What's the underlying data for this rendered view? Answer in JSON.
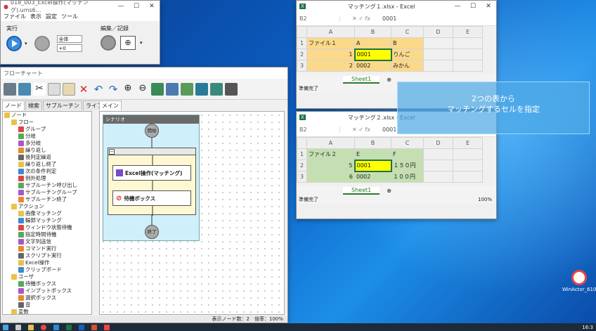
{
  "winactor_main": {
    "title": "018_003_Excel操作(マッチング).ums6...",
    "menu": [
      "ファイル",
      "表示",
      "設定",
      "ツール"
    ],
    "run_label": "実行",
    "edit_label": "編集／記録",
    "scope_value": "全体",
    "speed_value": "+0"
  },
  "flowchart": {
    "title": "フローチャート",
    "tabs": [
      "ノード",
      "検索",
      "サブルーチン",
      "ライブラリ"
    ],
    "main_tab": "メイン",
    "tree": [
      {
        "label": "ノード",
        "level": 0
      },
      {
        "label": "フロー",
        "level": 1
      },
      {
        "label": "グループ",
        "level": 2
      },
      {
        "label": "分岐",
        "level": 2
      },
      {
        "label": "多分岐",
        "level": 2
      },
      {
        "label": "繰り返し",
        "level": 2
      },
      {
        "label": "後判定繰返",
        "level": 2
      },
      {
        "label": "繰り返し終了",
        "level": 2
      },
      {
        "label": "次の条件判定",
        "level": 2
      },
      {
        "label": "例外処理",
        "level": 2
      },
      {
        "label": "サブルーチン呼び出し",
        "level": 2
      },
      {
        "label": "サブルーチングループ",
        "level": 2
      },
      {
        "label": "サブルーチン終了",
        "level": 2
      },
      {
        "label": "アクション",
        "level": 1
      },
      {
        "label": "画像マッチング",
        "level": 2
      },
      {
        "label": "輪郭マッチング",
        "level": 2
      },
      {
        "label": "ウィンドウ状態待機",
        "level": 2
      },
      {
        "label": "指定時間待機",
        "level": 2
      },
      {
        "label": "文字列送信",
        "level": 2
      },
      {
        "label": "コマンド実行",
        "level": 2
      },
      {
        "label": "スクリプト実行",
        "level": 2
      },
      {
        "label": "Excel操作",
        "level": 2
      },
      {
        "label": "クリップボード",
        "level": 2
      },
      {
        "label": "ユーザ",
        "level": 1
      },
      {
        "label": "待機ボックス",
        "level": 2
      },
      {
        "label": "インプットボックス",
        "level": 2
      },
      {
        "label": "選択ボックス",
        "level": 2
      },
      {
        "label": "音",
        "level": 2
      },
      {
        "label": "変数",
        "level": 1
      }
    ],
    "scenario_label": "シナリオ",
    "start_label": "開始",
    "end_label": "終了",
    "node1": "Excel操作(マッチング)",
    "node2": "待機ボックス",
    "status": "表示ノード数：2　倍率：100%"
  },
  "excel1": {
    "title": "マッチング１.xlsx - Excel",
    "namebox": "B2",
    "formula": "0001",
    "cols": [
      "A",
      "B",
      "C",
      "D",
      "E"
    ],
    "rows": [
      {
        "num": "1",
        "cells": [
          "ファイル１",
          "A",
          "B",
          "",
          ""
        ]
      },
      {
        "num": "2",
        "cells": [
          "1",
          "0001",
          "りんご",
          "",
          ""
        ]
      },
      {
        "num": "3",
        "cells": [
          "2",
          "0002",
          "みかん",
          "",
          ""
        ]
      }
    ],
    "sheet": "Sheet1",
    "status": "準備完了"
  },
  "excel2": {
    "title": "マッチング２.xlsx - Excel",
    "namebox": "B2",
    "formula": "0001",
    "cols": [
      "A",
      "B",
      "C",
      "D",
      "E"
    ],
    "rows": [
      {
        "num": "1",
        "cells": [
          "ファイル２",
          "E",
          "F",
          "",
          ""
        ]
      },
      {
        "num": "2",
        "cells": [
          "5",
          "0001",
          "１５０円",
          "",
          ""
        ]
      },
      {
        "num": "3",
        "cells": [
          "6",
          "0002",
          "１００円",
          "",
          ""
        ]
      }
    ],
    "sheet": "Sheet1",
    "status": "準備完了",
    "zoom": "100%"
  },
  "callout": {
    "line1": "2つの表から",
    "line2": "マッチングするセルを指定"
  },
  "desktop": {
    "shortcut_label": "WinActor_610"
  },
  "clock": "16:3"
}
